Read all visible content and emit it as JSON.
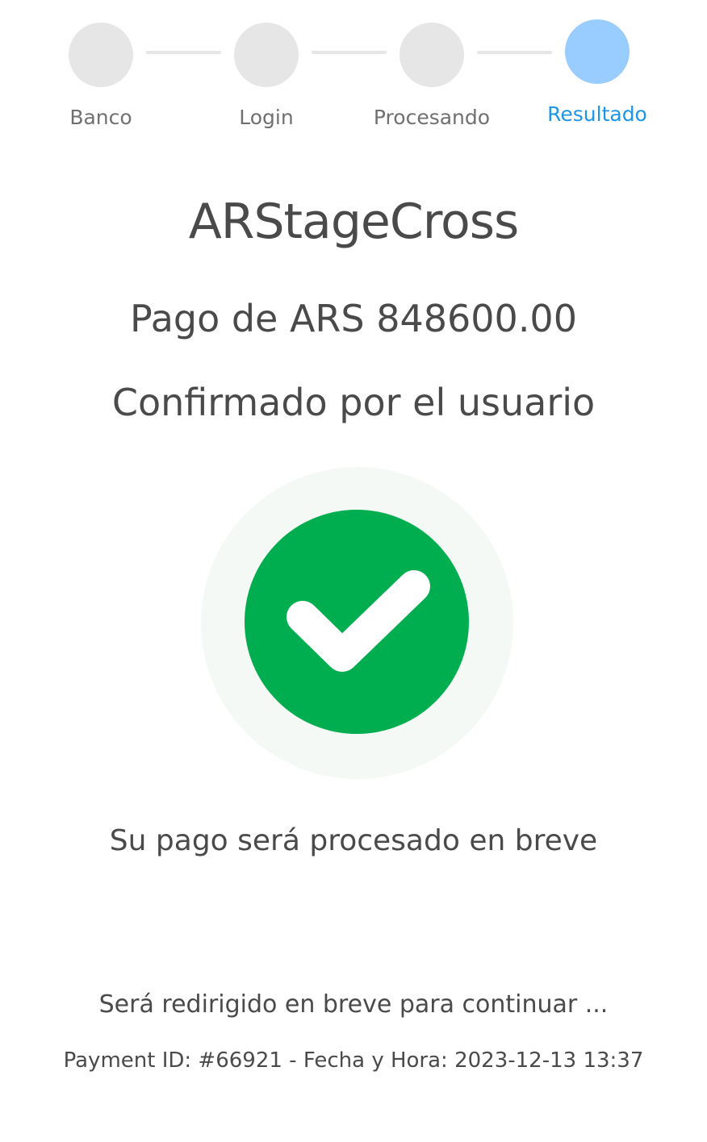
{
  "stepper": {
    "steps": [
      {
        "label": "Banco",
        "active": false
      },
      {
        "label": "Login",
        "active": false
      },
      {
        "label": "Procesando",
        "active": false
      },
      {
        "label": "Resultado",
        "active": true
      }
    ]
  },
  "merchant": {
    "name": "ARStageCross"
  },
  "payment": {
    "amount_text": "Pago de ARS 848600.00",
    "status_text": "Confirmado por el usuario",
    "notice_text": "Su pago será procesado en breve",
    "redirect_text": "Será redirigido en breve para continuar ...",
    "footer_text": "Payment ID: #66921 - Fecha y Hora: 2023-12-13 13:37"
  },
  "icons": {
    "success": "check-circle-icon"
  },
  "colors": {
    "step_inactive": "#e6e6e6",
    "step_active": "#99ccff",
    "step_active_label": "#1e95e6",
    "success": "#00ae50",
    "halo": "#f5f9f6",
    "text": "#4a4a4a"
  }
}
